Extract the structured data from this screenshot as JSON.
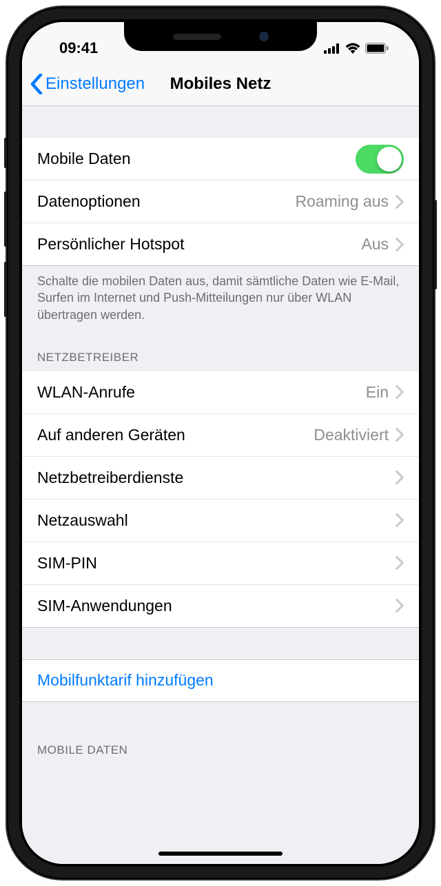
{
  "status": {
    "time": "09:41"
  },
  "nav": {
    "back_label": "Einstellungen",
    "title": "Mobiles Netz"
  },
  "section1": {
    "mobile_data_label": "Mobile Daten",
    "mobile_data_on": true,
    "data_options_label": "Datenoptionen",
    "data_options_value": "Roaming aus",
    "hotspot_label": "Persönlicher Hotspot",
    "hotspot_value": "Aus",
    "footer": "Schalte die mobilen Daten aus, damit sämtliche Daten wie E-Mail, Surfen im Internet und Push-Mitteilungen nur über WLAN übertragen werden."
  },
  "section2": {
    "header": "NETZBETREIBER",
    "wlan_calls_label": "WLAN-Anrufe",
    "wlan_calls_value": "Ein",
    "other_devices_label": "Auf anderen Geräten",
    "other_devices_value": "Deaktiviert",
    "carrier_services_label": "Netzbetreiberdienste",
    "network_selection_label": "Netzauswahl",
    "sim_pin_label": "SIM-PIN",
    "sim_apps_label": "SIM-Anwendungen"
  },
  "action": {
    "add_plan_label": "Mobilfunktarif hinzufügen"
  },
  "section3": {
    "header": "MOBILE DATEN"
  }
}
